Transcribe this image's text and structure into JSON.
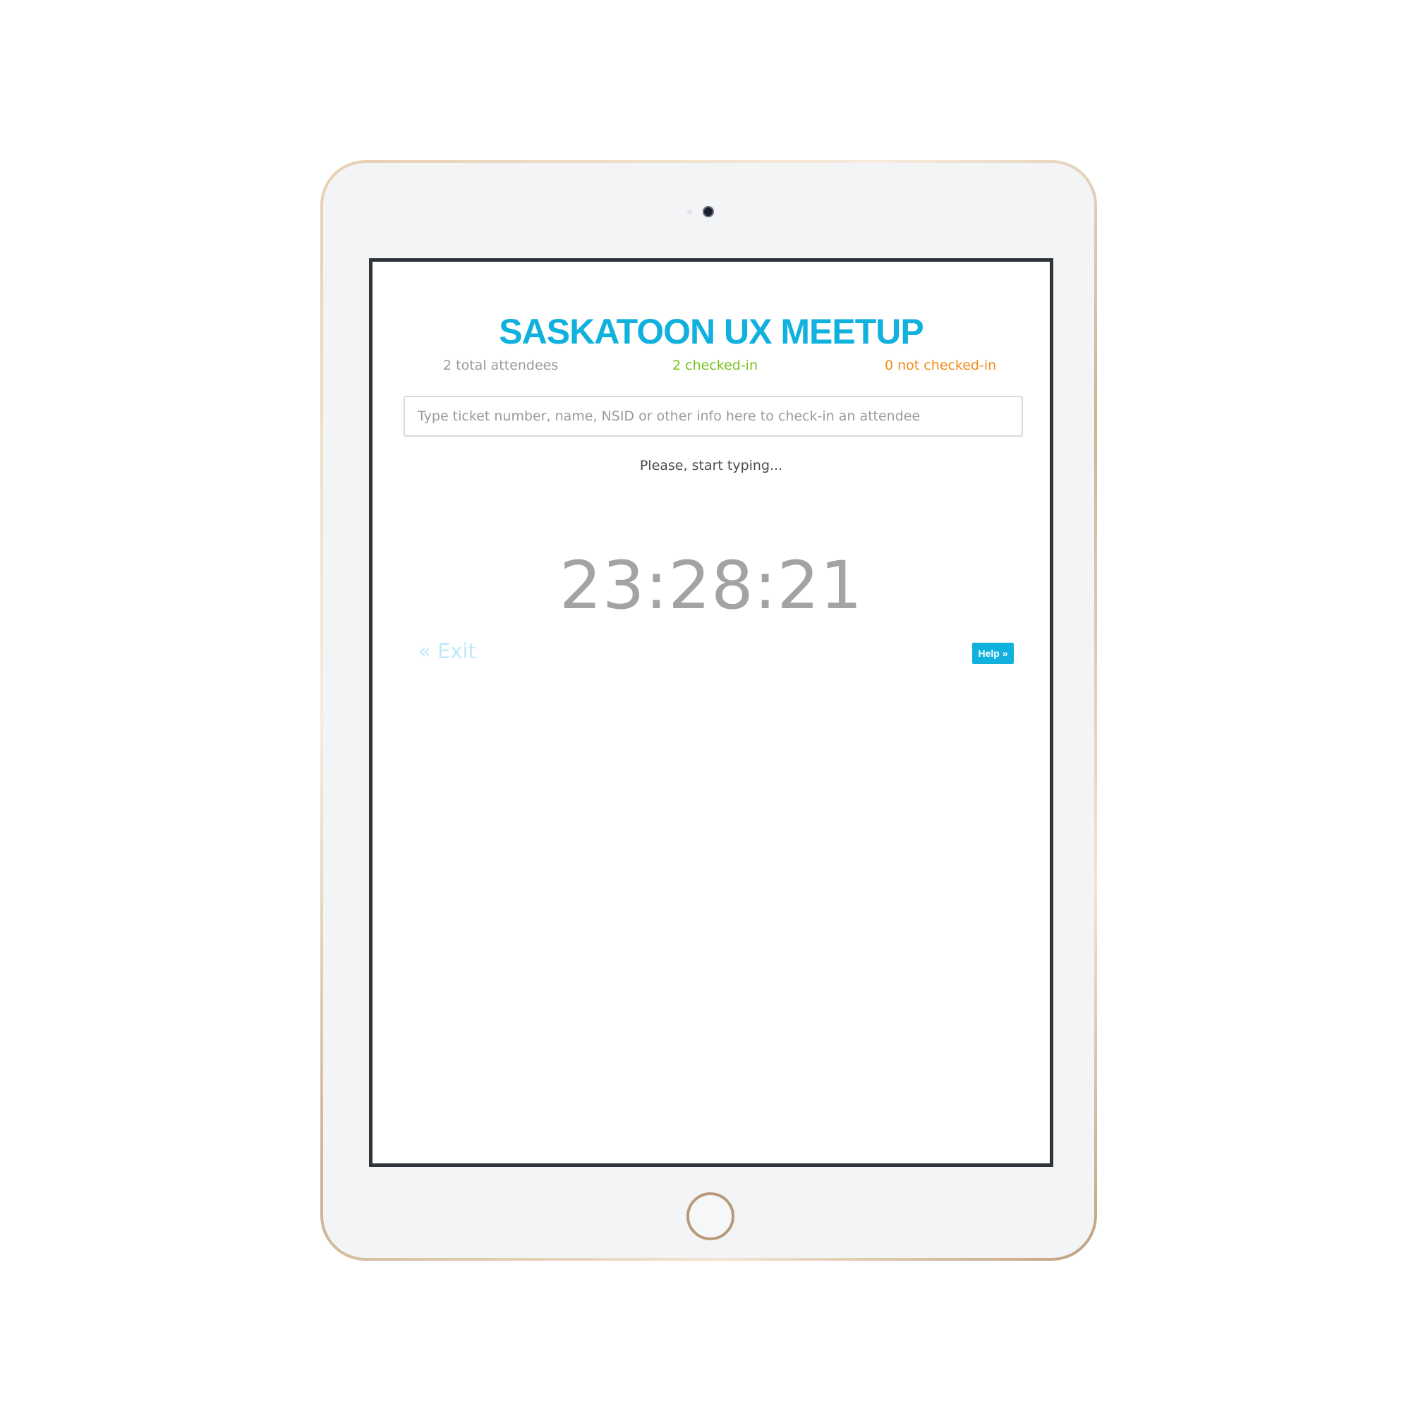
{
  "event": {
    "title": "SASKATOON UX MEETUP"
  },
  "stats": {
    "total_attendees": "2 total attendees",
    "checked_in": "2 checked-in",
    "not_checked_in": "0 not checked-in"
  },
  "search": {
    "placeholder": "Type ticket number, name, NSID or other info here to check-in an attendee",
    "value": ""
  },
  "status": {
    "message": "Please, start typing..."
  },
  "clock": {
    "time": "23:28:21"
  },
  "navigation": {
    "exit_label": "« Exit",
    "help_label": "Help »"
  },
  "colors": {
    "brand": "#11b1de",
    "checked_in": "#7cc11f",
    "not_checked_in": "#f08c16",
    "muted": "#9a9a9a",
    "device_frame": "#d9bf9f",
    "screen_border": "#2f343a"
  },
  "icons": {
    "camera": "camera-icon",
    "home_button": "home-button"
  }
}
